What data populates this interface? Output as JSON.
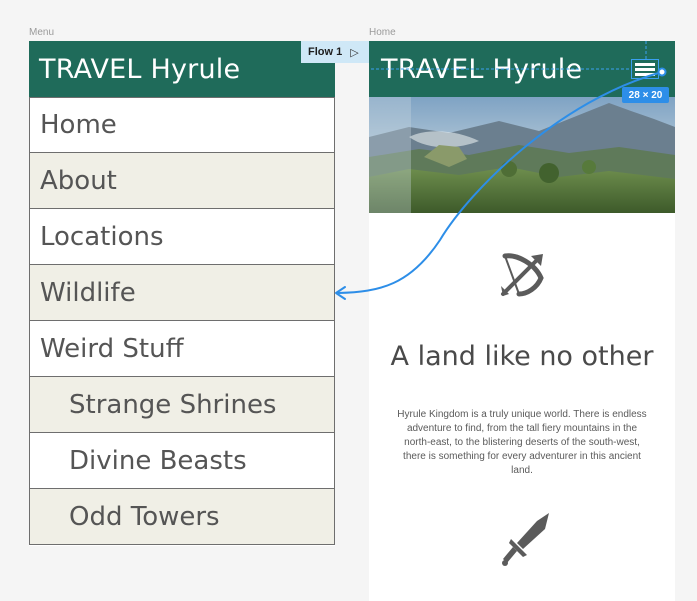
{
  "canvas": {
    "menu_frame_label": "Menu",
    "home_frame_label": "Home"
  },
  "menu_frame": {
    "app_title": "TRAVEL Hyrule",
    "items": [
      {
        "label": "Home"
      },
      {
        "label": "About"
      },
      {
        "label": "Locations"
      },
      {
        "label": "Wildlife"
      },
      {
        "label": "Weird Stuff"
      },
      {
        "label": "Strange Shrines"
      },
      {
        "label": "Divine Beasts"
      },
      {
        "label": "Odd Towers"
      }
    ]
  },
  "flow": {
    "label": "Flow 1",
    "play_icon": "play-icon"
  },
  "home_frame": {
    "app_title": "TRAVEL Hyrule",
    "menu_icon": "hamburger-menu-icon",
    "hero_image": "landscape-image",
    "section_icon_1": "bow-and-arrow-icon",
    "headline": "A land like no other",
    "body": "Hyrule Kingdom is a truly unique world. There is endless adventure to find, from the tall fiery mountains in the north-east, to the blistering deserts of the south-west, there is something for every adventurer in this ancient land.",
    "section_icon_2": "sword-icon"
  },
  "selection": {
    "size_label": "28 × 20"
  },
  "colors": {
    "header": "#1f6b5a",
    "menu_alt_row": "#f0efe6",
    "prototype_blue": "#2d8ee8",
    "flow_badge": "#cfe8f7",
    "icon_gray": "#5b5b5b"
  }
}
